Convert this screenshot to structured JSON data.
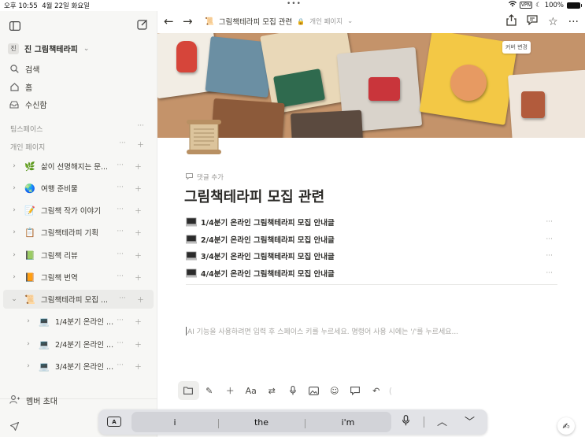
{
  "status_bar": {
    "time": "오후 10:55",
    "date": "4월 22일 화요일",
    "vpn": "VPN",
    "battery": "100%"
  },
  "sidebar": {
    "workspace_badge": "진",
    "workspace_name": "진 그림책테라피",
    "nav": [
      {
        "label": "검색",
        "icon": "search-icon"
      },
      {
        "label": "홈",
        "icon": "home-icon"
      },
      {
        "label": "수신함",
        "icon": "inbox-icon"
      }
    ],
    "section_teamspace": "팀스페이스",
    "section_private": "개인 페이지",
    "pages": [
      {
        "label": "삶이 선명해지는 문...",
        "emoji": "🌿"
      },
      {
        "label": "여행 준비물",
        "emoji": "🌏"
      },
      {
        "label": "그림책 작가 이야기",
        "emoji": "📝"
      },
      {
        "label": "그림책테라피 기획",
        "emoji": "📋"
      },
      {
        "label": "그림책 리뷰",
        "emoji": "📗"
      },
      {
        "label": "그림책 번역",
        "emoji": "📙"
      },
      {
        "label": "그림책테라피 모집 ...",
        "emoji": "📜"
      }
    ],
    "subpages": [
      {
        "label": "1/4분기 온라인 ..."
      },
      {
        "label": "2/4분기 온라인 ..."
      },
      {
        "label": "3/4분기 온라인 ..."
      }
    ],
    "member_invite": "멤버 초대"
  },
  "topbar": {
    "breadcrumb_title": "그림책테라피 모집 관련",
    "breadcrumb_location": "개인 페이지"
  },
  "cover": {
    "change_button": "커버 변경"
  },
  "page": {
    "add_comment": "댓글 추가",
    "title": "그림책테라피 모집 관련",
    "subpages": [
      "1/4분기 온라인 그림책테라피 모집 안내글",
      "2/4분기 온라인 그림책테라피 모집 안내글",
      "3/4분기 온라인 그림책테라피 모집 안내글",
      "4/4분기 온라인 그림책테라피 모집 안내글"
    ],
    "placeholder": "AI 기능을 사용하려면 입력 후 스페이스 키를 누르세요. 명령어 사용 시에는 '/'를 누르세요..."
  },
  "keyboard": {
    "suggestions": [
      "i",
      "the",
      "i'm"
    ],
    "key_a": "A"
  },
  "editor_toolbar": [
    "folder-icon",
    "ai-pen-icon",
    "plus-icon",
    "text-format-icon",
    "turn-into-icon",
    "mic-icon",
    "image-icon",
    "emoji-icon",
    "comment-icon",
    "undo-icon"
  ],
  "colors": {
    "sidebar_bg": "#f7f7f5",
    "text": "#37352f",
    "muted": "#91918e"
  }
}
